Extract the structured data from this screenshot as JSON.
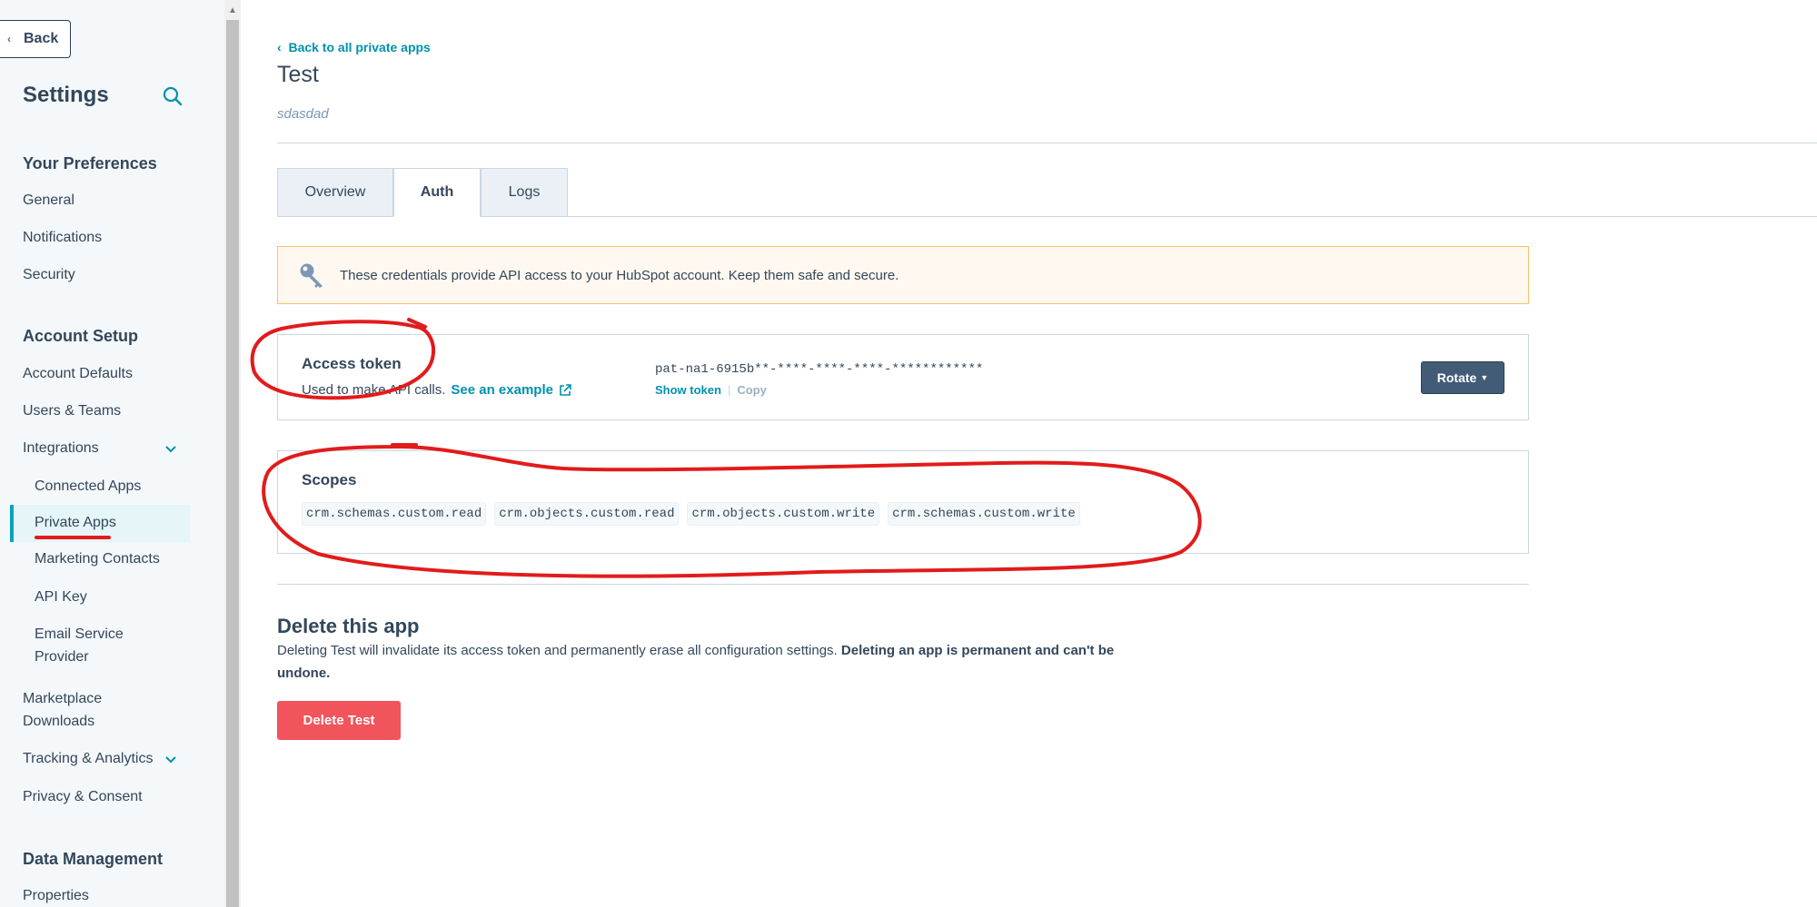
{
  "sidebar": {
    "back_label": "Back",
    "title": "Settings",
    "sections": {
      "preferences": "Your Preferences",
      "account_setup": "Account Setup",
      "data_management": "Data Management"
    },
    "items": {
      "general": "General",
      "notifications": "Notifications",
      "security": "Security",
      "account_defaults": "Account Defaults",
      "users_teams": "Users & Teams",
      "integrations": "Integrations",
      "connected_apps": "Connected Apps",
      "private_apps": "Private Apps",
      "marketing_contacts": "Marketing Contacts",
      "api_key": "API Key",
      "email_service_provider_1": "Email Service",
      "email_service_provider_2": "Provider",
      "marketplace_downloads_1": "Marketplace",
      "marketplace_downloads_2": "Downloads",
      "tracking_analytics": "Tracking & Analytics",
      "privacy_consent": "Privacy & Consent",
      "properties": "Properties"
    }
  },
  "main": {
    "back_link": "Back to all private apps",
    "app_title": "Test",
    "app_description": "sdasdad",
    "tabs": [
      {
        "label": "Overview"
      },
      {
        "label": "Auth"
      },
      {
        "label": "Logs"
      }
    ],
    "alert_text": "These credentials provide API access to your HubSpot account. Keep them safe and secure.",
    "access_token": {
      "title": "Access token",
      "description": "Used to make API calls.",
      "see_example": "See an example",
      "token_value": "pat-na1-6915b**-****-****-****-************",
      "show_token": "Show token",
      "separator": "|",
      "copy": "Copy",
      "rotate": "Rotate"
    },
    "scopes": {
      "title": "Scopes",
      "items": [
        "crm.schemas.custom.read",
        "crm.objects.custom.read",
        "crm.objects.custom.write",
        "crm.schemas.custom.write"
      ]
    },
    "delete": {
      "title": "Delete this app",
      "text_plain": "Deleting Test will invalidate its access token and permanently erase all configuration settings.",
      "text_bold": "Deleting an app is permanent and can't be undone.",
      "button": "Delete Test"
    }
  },
  "colors": {
    "accent": "#0091ae",
    "sidebar_bg": "#f5f8fa",
    "danger": "#f2545b",
    "annotation_red": "#e21b1b"
  }
}
